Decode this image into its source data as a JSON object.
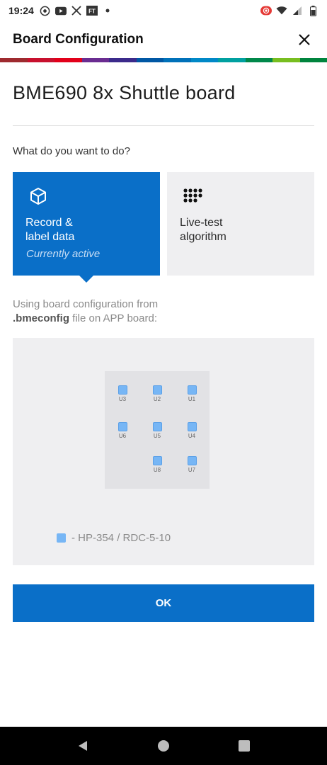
{
  "status_bar": {
    "time": "19:24",
    "left_icons": [
      "camera-record-icon",
      "youtube-icon",
      "x-icon",
      "ft-icon",
      "dot-icon"
    ],
    "ft_label": "FT",
    "right_icons": [
      "recording-icon",
      "wifi-icon",
      "signal-icon",
      "battery-icon"
    ]
  },
  "header": {
    "title": "Board Configuration",
    "close_icon": "close-icon"
  },
  "brand_colors": [
    "#9e2a2f",
    "#c8102e",
    "#e2001a",
    "#6a2c91",
    "#3b2a8b",
    "#0057a4",
    "#0071b9",
    "#0088c7",
    "#00a0a0",
    "#00884a",
    "#78be20",
    "#00843d"
  ],
  "board": {
    "title": "BME690 8x Shuttle board"
  },
  "question": "What do you want to do?",
  "modes": [
    {
      "label": "Record &\nlabel data",
      "subtitle": "Currently active",
      "icon": "cube-icon",
      "active": true
    },
    {
      "label": "Live-test\nalgorithm",
      "icon": "dot-grid-icon",
      "active": false
    }
  ],
  "info": {
    "prefix": "Using board configuration from",
    "file": ".bmeconfig",
    "suffix": " file on APP board:"
  },
  "sensors": [
    {
      "id": "U3"
    },
    {
      "id": "U2"
    },
    {
      "id": "U1"
    },
    {
      "id": "U6"
    },
    {
      "id": "U5"
    },
    {
      "id": "U4"
    },
    {
      "id": "U8"
    },
    {
      "id": "U7"
    }
  ],
  "legend": {
    "color": "#77b6f5",
    "label": "- HP-354 / RDC-5-10"
  },
  "ok_button": {
    "label": "OK"
  },
  "nav": {
    "back_icon": "back-icon",
    "home_icon": "home-icon",
    "recents_icon": "recents-icon"
  }
}
